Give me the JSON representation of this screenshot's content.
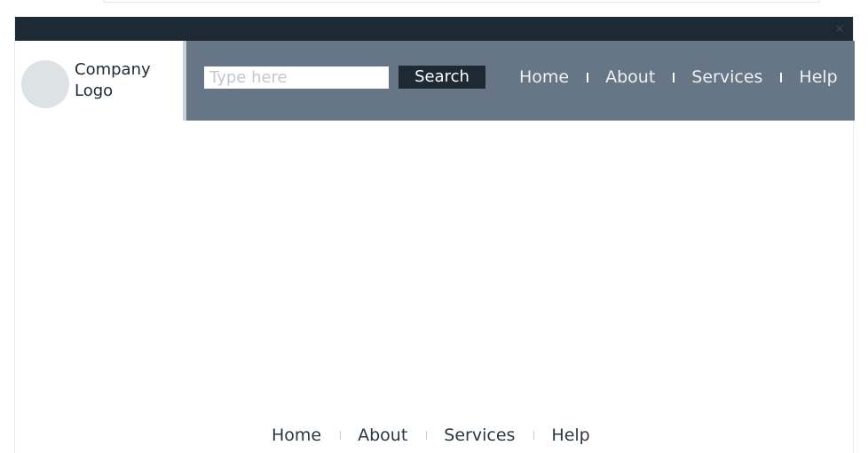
{
  "window": {
    "close_icon": "close-icon",
    "close_glyph": "×"
  },
  "logo": {
    "line1": "Company",
    "line2": "Logo"
  },
  "search": {
    "placeholder": "Type here",
    "value": "",
    "button_label": "Search"
  },
  "nav": {
    "items": [
      {
        "label": "Home"
      },
      {
        "label": "About"
      },
      {
        "label": "Services"
      },
      {
        "label": "Help"
      }
    ]
  },
  "footer": {
    "items": [
      {
        "label": "Home"
      },
      {
        "label": "About"
      },
      {
        "label": "Services"
      },
      {
        "label": "Help"
      }
    ]
  },
  "colors": {
    "topbar": "#1d2a33",
    "navband": "#677686",
    "accent_border": "#c9d1d8",
    "logo_circle": "#dde2e5",
    "button": "#1d2a33"
  }
}
